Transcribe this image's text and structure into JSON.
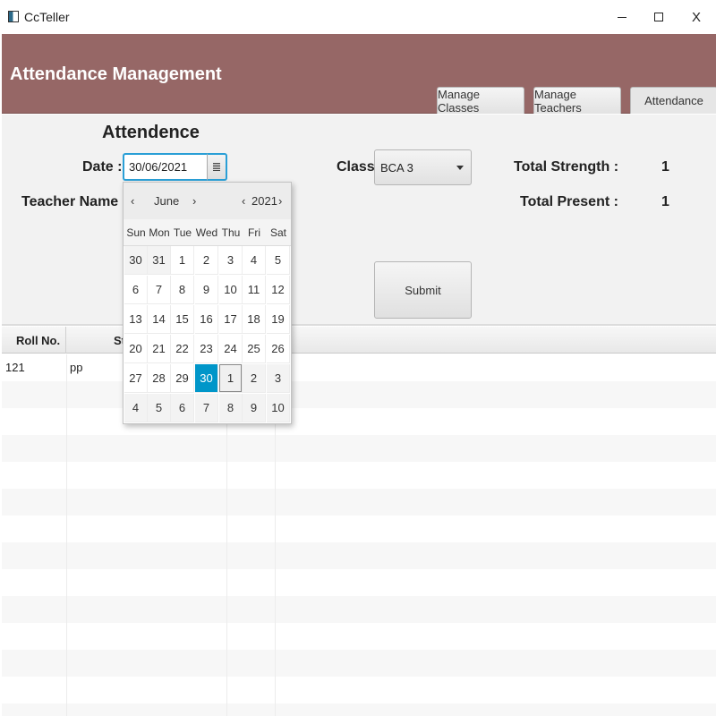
{
  "window": {
    "title": "CcTeller",
    "minimize_glyph": "",
    "maximize_glyph": "",
    "close_glyph": "X"
  },
  "header": {
    "title": "Attendance Management",
    "color": "#966766",
    "tabs": [
      {
        "label": "Manage Classes"
      },
      {
        "label": "Manage Teachers"
      },
      {
        "label": "Attendance"
      }
    ]
  },
  "form": {
    "section_title": "Attendence",
    "date_label": "Date :",
    "date_value": "30/06/2021",
    "teacher_label": "Teacher Name :",
    "class_label": "Class",
    "class_value": "BCA 3",
    "total_strength_label": "Total Strength :",
    "total_strength_value": "1",
    "total_present_label": "Total Present :",
    "total_present_value": "1",
    "submit_label": "Submit"
  },
  "table": {
    "columns": [
      "Roll No.",
      "St"
    ],
    "rows": [
      {
        "roll": "121",
        "name": "pp"
      }
    ]
  },
  "date_picker": {
    "prev_month": "‹",
    "month": "June",
    "next_month": "›",
    "prev_year": "‹",
    "year": "2021",
    "next_year": "›",
    "selected_color": "#0096c9",
    "weekdays": [
      "Sun",
      "Mon",
      "Tue",
      "Wed",
      "Thu",
      "Fri",
      "Sat"
    ],
    "weeks": [
      [
        "30",
        "31",
        "1",
        "2",
        "3",
        "4",
        "5"
      ],
      [
        "6",
        "7",
        "8",
        "9",
        "10",
        "11",
        "12"
      ],
      [
        "13",
        "14",
        "15",
        "16",
        "17",
        "18",
        "19"
      ],
      [
        "20",
        "21",
        "22",
        "23",
        "24",
        "25",
        "26"
      ],
      [
        "27",
        "28",
        "29",
        "30",
        "1",
        "2",
        "3"
      ],
      [
        "4",
        "5",
        "6",
        "7",
        "8",
        "9",
        "10"
      ]
    ]
  }
}
